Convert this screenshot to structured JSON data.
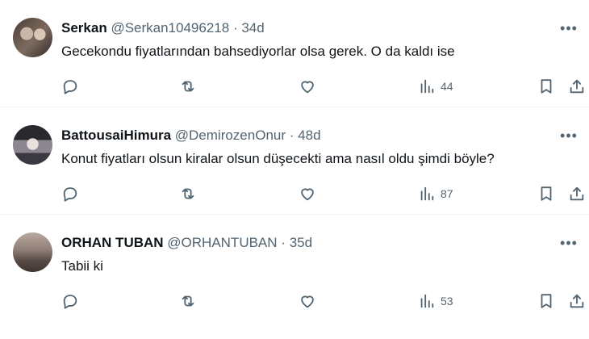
{
  "tweets": [
    {
      "name": "Serkan",
      "handle": "@Serkan10496218",
      "separator": "·",
      "age": "34d",
      "text": "Gecekondu fiyatlarından bahsediyorlar olsa gerek. O da kaldı ise",
      "views": "44"
    },
    {
      "name": "BattousaiHimura",
      "handle": "@DemirozenOnur",
      "separator": "·",
      "age": "48d",
      "text": "Konut fiyatları olsun kiralar olsun düşecekti ama nasıl oldu şimdi böyle?",
      "views": "87"
    },
    {
      "name": "ORHAN TUBAN",
      "handle": "@ORHANTUBAN",
      "separator": "·",
      "age": "35d",
      "text": "Tabii ki",
      "views": "53"
    }
  ],
  "more_glyph": "•••",
  "icons": {
    "reply": "reply-icon",
    "retweet": "retweet-icon",
    "like": "heart-icon",
    "views": "views-chart-icon",
    "bookmark": "bookmark-icon",
    "share": "share-icon"
  }
}
